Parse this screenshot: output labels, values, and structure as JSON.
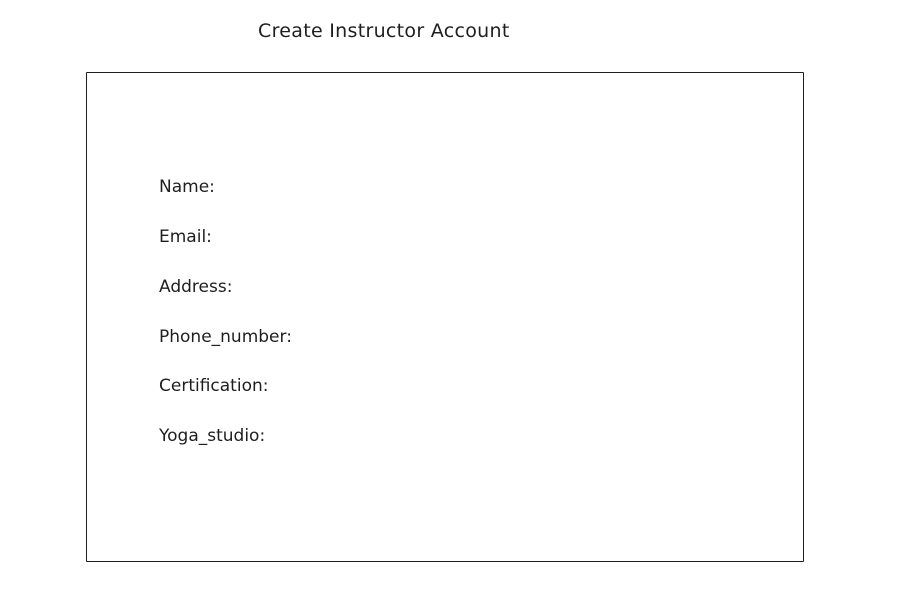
{
  "header": {
    "title": "Create Instructor Account"
  },
  "form": {
    "fields": [
      {
        "label": "Name:"
      },
      {
        "label": "Email:"
      },
      {
        "label": "Address:"
      },
      {
        "label": "Phone_number:"
      },
      {
        "label": "Certification:"
      },
      {
        "label": "Yoga_studio:"
      }
    ]
  }
}
